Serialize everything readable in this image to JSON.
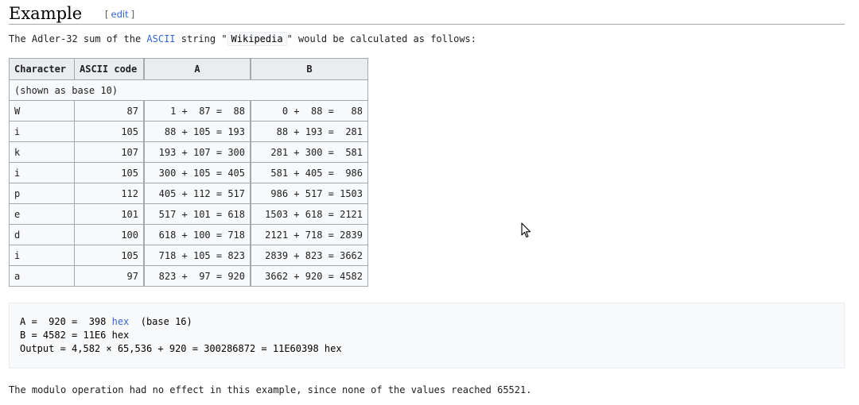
{
  "heading": {
    "title": "Example",
    "edit_open": "[",
    "edit_label": "edit",
    "edit_close": "]"
  },
  "intro": {
    "part1": "The Adler-32 sum of the ",
    "link": "ASCII",
    "part2": " string \"",
    "code": "Wikipedia",
    "part3": "\" would be calculated as follows:"
  },
  "table": {
    "headers": [
      "Character",
      "ASCII code",
      "A",
      "B"
    ],
    "note": "(shown as base 10)",
    "rows": [
      {
        "ch": "W",
        "code": "87",
        "a": "1 +  87 =  88",
        "b": "0 +  88 =   88"
      },
      {
        "ch": "i",
        "code": "105",
        "a": "88 + 105 = 193",
        "b": "88 + 193 =  281"
      },
      {
        "ch": "k",
        "code": "107",
        "a": "193 + 107 = 300",
        "b": "281 + 300 =  581"
      },
      {
        "ch": "i",
        "code": "105",
        "a": "300 + 105 = 405",
        "b": "581 + 405 =  986"
      },
      {
        "ch": "p",
        "code": "112",
        "a": "405 + 112 = 517",
        "b": "986 + 517 = 1503"
      },
      {
        "ch": "e",
        "code": "101",
        "a": "517 + 101 = 618",
        "b": "1503 + 618 = 2121"
      },
      {
        "ch": "d",
        "code": "100",
        "a": "618 + 100 = 718",
        "b": "2121 + 718 = 2839"
      },
      {
        "ch": "i",
        "code": "105",
        "a": "718 + 105 = 823",
        "b": "2839 + 823 = 3662"
      },
      {
        "ch": "a",
        "code": "97",
        "a": "823 +  97 = 920",
        "b": "3662 + 920 = 4582"
      }
    ]
  },
  "output": {
    "line1_a": "A =  920 =  398 ",
    "line1_link": "hex",
    "line1_b": "  (base 16)",
    "line2": "B = 4582 = 11E6 hex",
    "line3": "Output = 4,582 × 65,536 + 920 = 300286872 = 11E60398 hex"
  },
  "closing": "The modulo operation had no effect in this example, since none of the values reached 65521.",
  "icons": {
    "cursor": "mouse-pointer-icon"
  },
  "colors": {
    "link": "#3366cc",
    "table_bg": "#f8f9fa",
    "header_bg": "#eaecf0",
    "border": "#a2a9b1"
  }
}
